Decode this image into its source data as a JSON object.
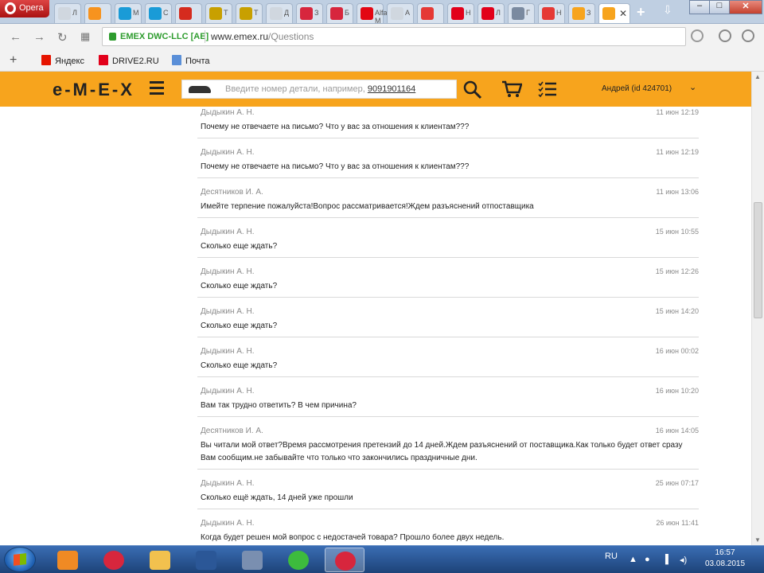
{
  "browser": {
    "app_name": "Opera",
    "tabs": [
      {
        "label": "Л",
        "icon": "page-icon",
        "color": "#d0d7df"
      },
      {
        "label": "",
        "icon": "odnoklassniki-icon",
        "color": "#f7931e"
      },
      {
        "label": "М",
        "icon": "mail-at-icon",
        "color": "#1a9bd7"
      },
      {
        "label": "С",
        "icon": "mail-at-icon",
        "color": "#1a9bd7"
      },
      {
        "label": "",
        "icon": "russia-flag-icon",
        "color": "#d52b1e"
      },
      {
        "label": "Т",
        "icon": "pen-icon",
        "color": "#c8a000"
      },
      {
        "label": "Т",
        "icon": "pen-icon",
        "color": "#c8a000"
      },
      {
        "label": "Д",
        "icon": "page-icon",
        "color": "#d0d7df"
      },
      {
        "label": "З",
        "icon": "red-square-icon",
        "color": "#d7263d"
      },
      {
        "label": "Б",
        "icon": "red-square-icon",
        "color": "#d7263d"
      },
      {
        "label": "Alfa М",
        "icon": "alfa-icon",
        "color": "#e30613"
      },
      {
        "label": "А",
        "icon": "page-icon",
        "color": "#d0d7df"
      },
      {
        "label": "",
        "icon": "lifebuoy-icon",
        "color": "#e53935"
      },
      {
        "label": "Н",
        "icon": "drive2-icon",
        "color": "#e2001a"
      },
      {
        "label": "Л",
        "icon": "drive2-icon",
        "color": "#e2001a"
      },
      {
        "label": "Г",
        "icon": "car-icon",
        "color": "#7a8aa0"
      },
      {
        "label": "Н",
        "icon": "lifebuoy-icon",
        "color": "#e53935"
      },
      {
        "label": "З",
        "icon": "emex-icon",
        "color": "#f7a41d"
      },
      {
        "label": "",
        "icon": "emex-icon",
        "color": "#f7a41d",
        "active": true
      }
    ],
    "new_tab_label": "+",
    "tab_menu_label": "⇩",
    "site_identity": "EMEX DWC-LLC [AE]",
    "url_host": "www.emex.ru",
    "url_path": "/Questions",
    "bookmarks": [
      {
        "label": "Яндекс",
        "icon": "yandex-icon",
        "color": "#e61400"
      },
      {
        "label": "DRIVE2.RU",
        "icon": "drive2-icon",
        "color": "#e2001a"
      },
      {
        "label": "Почта",
        "icon": "mail-icon",
        "color": "#5a8fd8"
      }
    ]
  },
  "site": {
    "logo": "e-M-E-X",
    "search_placeholder": "Введите номер детали, например,",
    "search_example": "9091901164",
    "user_label": "Андрей (id 424701)",
    "accent_color": "#f7a41d"
  },
  "messages": [
    {
      "author": "Дыдыкин А. Н.",
      "time": "11 июн 12:19",
      "text": "Почему не отвечаете на письмо? Что у вас за отношения к клиентам???"
    },
    {
      "author": "Дыдыкин А. Н.",
      "time": "11 июн 12:19",
      "text": "Почему не отвечаете на письмо? Что у вас за отношения к клиентам???"
    },
    {
      "author": "Десятников И. А.",
      "time": "11 июн 13:06",
      "text": "Имейте терпение пожалуйста!Вопрос рассматривается!Ждем разъяснений отпоставщика"
    },
    {
      "author": "Дыдыкин А. Н.",
      "time": "15 июн 10:55",
      "text": "Сколько еще ждать?"
    },
    {
      "author": "Дыдыкин А. Н.",
      "time": "15 июн 12:26",
      "text": "Сколько еще ждать?"
    },
    {
      "author": "Дыдыкин А. Н.",
      "time": "15 июн 14:20",
      "text": "Сколько еще ждать?"
    },
    {
      "author": "Дыдыкин А. Н.",
      "time": "16 июн 00:02",
      "text": "Сколько еще ждать?"
    },
    {
      "author": "Дыдыкин А. Н.",
      "time": "16 июн 10:20",
      "text": "Вам так трудно ответить? В чем причина?"
    },
    {
      "author": "Десятников И. А.",
      "time": "16 июн 14:05",
      "text": "Вы читали мой ответ?Время рассмотрения претензий до 14 дней.Ждем разъяснений от поставщика.Как только будет ответ сразу Вам сообщим.не забывайте что только что закончились праздничные дни."
    },
    {
      "author": "Дыдыкин А. Н.",
      "time": "25 июн 07:17",
      "text": "Сколько ещё ждать, 14 дней уже прошли"
    },
    {
      "author": "Дыдыкин А. Н.",
      "time": "26 июн 11:41",
      "text": "Когда будет решен мой вопрос с недостачей товара? Прошло более двух недель."
    }
  ],
  "taskbar": {
    "apps": [
      {
        "name": "media-player-icon",
        "color": "#f08a24"
      },
      {
        "name": "opera-icon",
        "color": "#d7263d"
      },
      {
        "name": "folder-icon",
        "color": "#f2c14e"
      },
      {
        "name": "word-icon",
        "color": "#2b5797"
      },
      {
        "name": "emblem-icon",
        "color": "#7a8fb0"
      },
      {
        "name": "mail-agent-icon",
        "color": "#3dbb3d"
      },
      {
        "name": "opera-icon",
        "color": "#d7263d",
        "active": true
      }
    ],
    "lang": "RU",
    "tray_icons": [
      "▲",
      "●",
      "▐",
      "◂)"
    ],
    "time": "16:57",
    "date": "03.08.2015"
  }
}
